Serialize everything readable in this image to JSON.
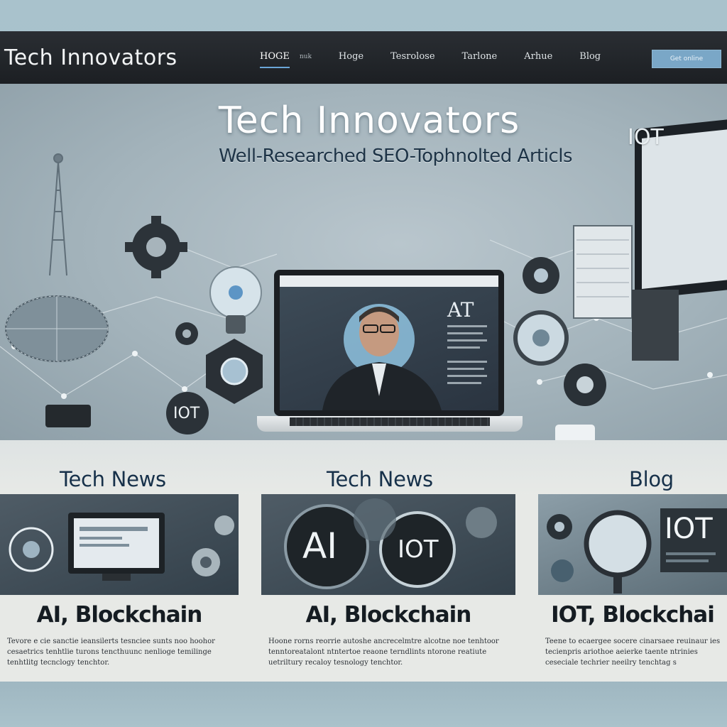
{
  "navbar": {
    "brand": "Tech Innovators",
    "links": [
      {
        "label": "HOGE",
        "active": true
      },
      {
        "label": "nuk",
        "small": true
      },
      {
        "label": "Hoge"
      },
      {
        "label": "Tesrolose"
      },
      {
        "label": "Tarlone"
      },
      {
        "label": "Arhue"
      },
      {
        "label": "Blog"
      }
    ],
    "cta_label": "Get online"
  },
  "hero": {
    "title": "Tech Innovators",
    "subtitle": "Well-Researched SEO-Tophnolted Articls",
    "floating_iot": "IOT",
    "badge_iot": "IOT",
    "laptop_ai": "AT"
  },
  "sections": [
    {
      "heading": "Tech News"
    },
    {
      "heading": "Tech News"
    },
    {
      "heading": "Blog"
    }
  ],
  "cards": [
    {
      "title": "AI, Blockchain",
      "body": "Tevore e cie sanctie ieansilerts tesnciee sunts noo hoohor cesaetrics tenhtlie turons tencthuunc nenlioge temilinge tenhtlitg tecnclogy tenchtor.",
      "overlay": []
    },
    {
      "title": "AI, Blockchain",
      "body": "Hoone rorns reorrie autoshe ancrecelmtre alcotne noe tenhtoor tenntoreatalont ntntertoe reaone terndlints ntorone reatiute uetriltury recaloy tesnology tenchtor.",
      "overlay": [
        "AI",
        "IOT"
      ]
    },
    {
      "title": "IOT, Blockchai",
      "body": "Teene to ecaergee socere cinarsaee reuinaur ies tecienpris ariothoe aeierke taente ntrinies ceseciale techrier neeilry tenchtag s",
      "overlay": [
        "IOT"
      ]
    }
  ],
  "colors": {
    "nav_bg": "#1f2226",
    "accent": "#6aa6d8",
    "heading": "#17314a"
  }
}
